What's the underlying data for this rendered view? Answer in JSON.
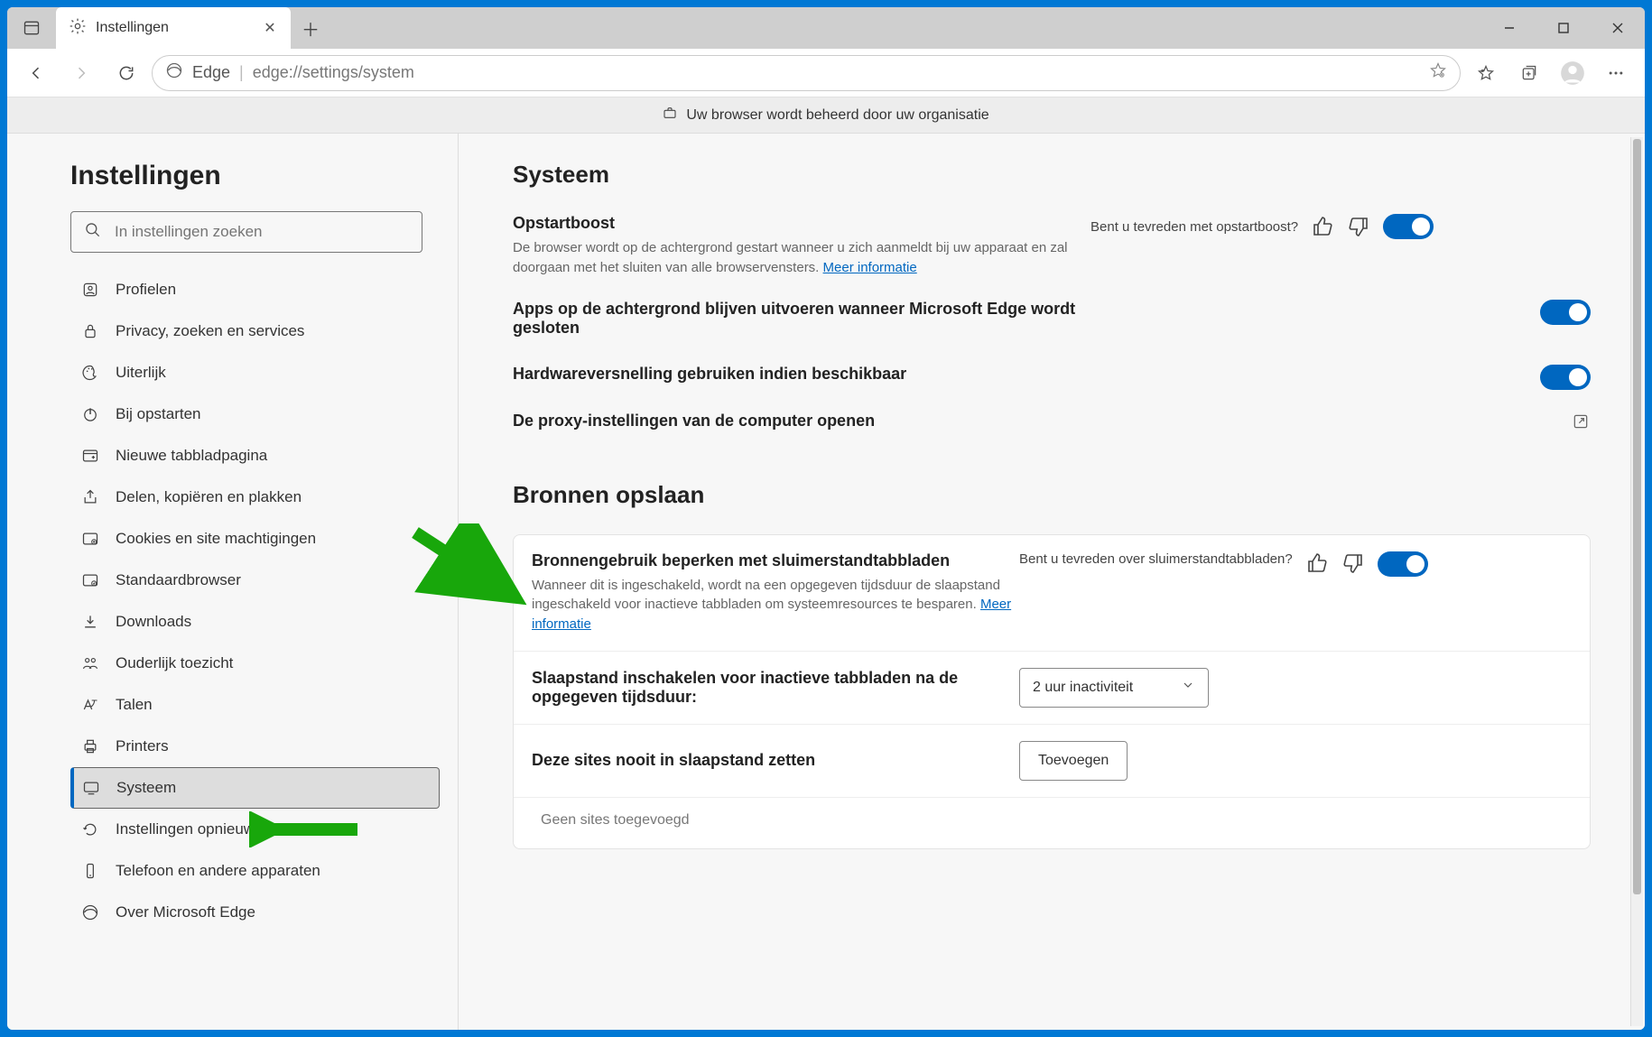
{
  "tab": {
    "title": "Instellingen"
  },
  "address": {
    "prefix": "Edge",
    "url": "edge://settings/system"
  },
  "banner": {
    "text": "Uw browser wordt beheerd door uw organisatie"
  },
  "sidebar": {
    "heading": "Instellingen",
    "search_placeholder": "In instellingen zoeken",
    "items": [
      {
        "label": "Profielen"
      },
      {
        "label": "Privacy, zoeken en services"
      },
      {
        "label": "Uiterlijk"
      },
      {
        "label": "Bij opstarten"
      },
      {
        "label": "Nieuwe tabbladpagina"
      },
      {
        "label": "Delen, kopiëren en plakken"
      },
      {
        "label": "Cookies en site machtigingen"
      },
      {
        "label": "Standaardbrowser"
      },
      {
        "label": "Downloads"
      },
      {
        "label": "Ouderlijk toezicht"
      },
      {
        "label": "Talen"
      },
      {
        "label": "Printers"
      },
      {
        "label": "Systeem"
      },
      {
        "label": "Instellingen opnieuw instellen"
      },
      {
        "label": "Telefoon en andere apparaten"
      },
      {
        "label": "Over Microsoft Edge"
      }
    ]
  },
  "main": {
    "heading": "Systeem",
    "startup": {
      "title": "Opstartboost",
      "desc": "De browser wordt op de achtergrond gestart wanneer u zich aanmeldt bij uw apparaat en zal doorgaan met het sluiten van alle browservensters. ",
      "more": "Meer informatie",
      "feedback_label": "Bent u tevreden met opstartboost?"
    },
    "bgApps": {
      "title": "Apps op de achtergrond blijven uitvoeren wanneer Microsoft Edge wordt gesloten"
    },
    "hwAccel": {
      "title": "Hardwareversnelling gebruiken indien beschikbaar"
    },
    "proxy": {
      "title": "De proxy-instellingen van de computer openen"
    },
    "section2_heading": "Bronnen opslaan",
    "sleeping": {
      "title": "Bronnengebruik beperken met sluimerstandtabbladen",
      "desc": "Wanneer dit is ingeschakeld, wordt na een opgegeven tijdsduur de slaapstand ingeschakeld voor inactieve tabbladen om systeemresources te besparen. ",
      "more": "Meer informatie",
      "feedback_label": "Bent u tevreden over sluimerstandtabbladen?"
    },
    "timeout": {
      "title": "Slaapstand inschakelen voor inactieve tabbladen na de opgegeven tijdsduur:",
      "value": "2 uur inactiviteit"
    },
    "never": {
      "title": "Deze sites nooit in slaapstand zetten",
      "add_label": "Toevoegen",
      "empty": "Geen sites toegevoegd"
    }
  }
}
